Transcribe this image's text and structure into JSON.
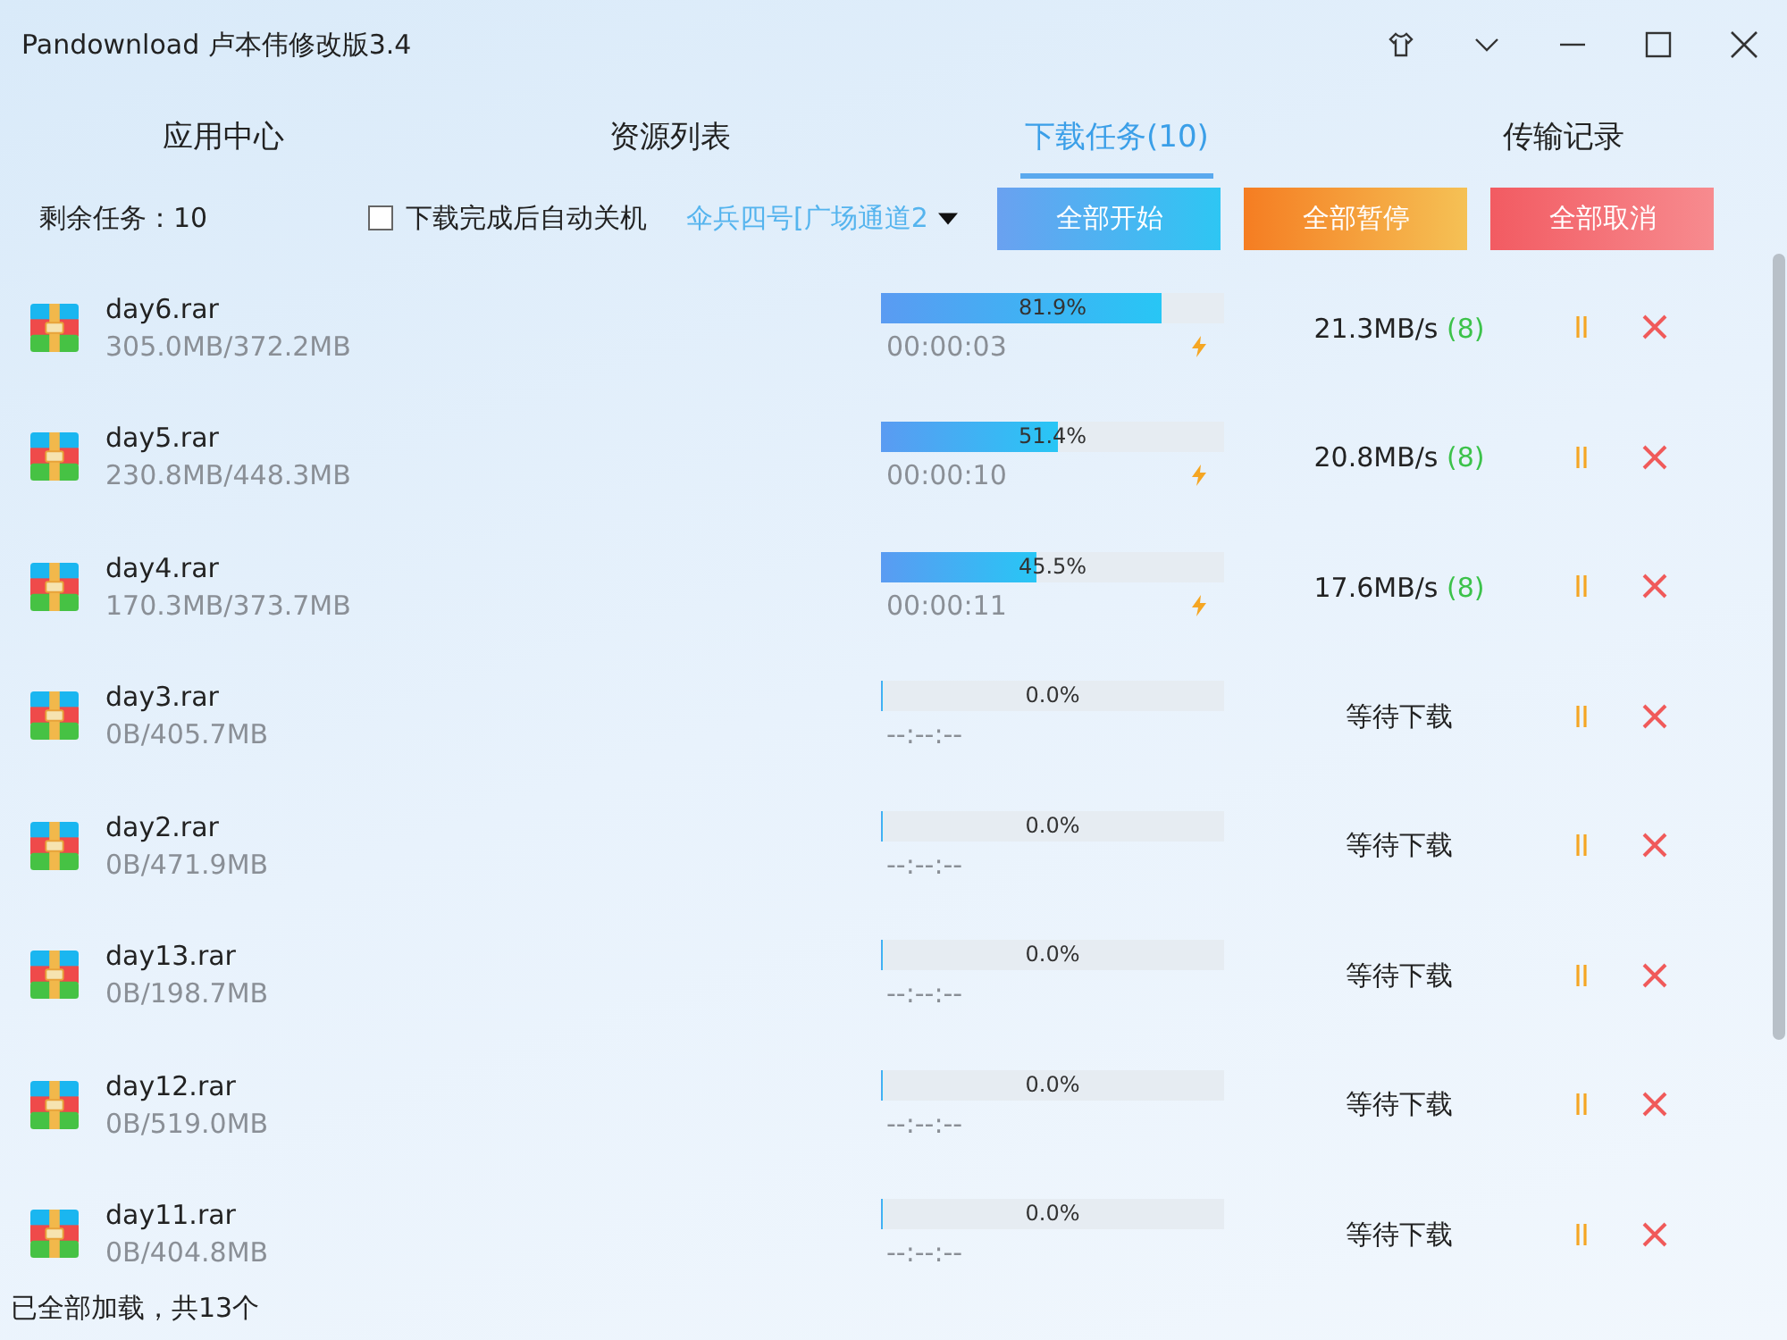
{
  "window": {
    "title": "Pandownload 卢本伟修改版3.4"
  },
  "tabs": [
    {
      "label": "应用中心",
      "selected": false
    },
    {
      "label": "资源列表",
      "selected": false
    },
    {
      "label": "下载任务(10)",
      "selected": true
    },
    {
      "label": "传输记录",
      "selected": false
    }
  ],
  "toolbar": {
    "remaining": "剩余任务：10",
    "auto_shutdown": {
      "label": "下载完成后自动关机",
      "checked": false
    },
    "channel": "伞兵四号[广场通道2",
    "buttons": [
      {
        "label": "全部开始",
        "kind": "start"
      },
      {
        "label": "全部暂停",
        "kind": "pause"
      },
      {
        "label": "全部取消",
        "kind": "cancel"
      }
    ]
  },
  "tasks": [
    {
      "name": "day6.rar",
      "size": "305.0MB/372.2MB",
      "level": 0.819,
      "percent": "81.9%",
      "time": "00:00:03",
      "kind": "active",
      "speed": "21.3MB/s",
      "threads": "(8)"
    },
    {
      "name": "day5.rar",
      "size": "230.8MB/448.3MB",
      "level": 0.514,
      "percent": "51.4%",
      "time": "00:00:10",
      "kind": "active",
      "speed": "20.8MB/s",
      "threads": "(8)"
    },
    {
      "name": "day4.rar",
      "size": "170.3MB/373.7MB",
      "level": 0.455,
      "percent": "45.5%",
      "time": "00:00:11",
      "kind": "active",
      "speed": "17.6MB/s",
      "threads": "(8)"
    },
    {
      "name": "day3.rar",
      "size": "0B/405.7MB",
      "level": 0,
      "percent": "0.0%",
      "time": "--:--:--",
      "kind": "waiting",
      "status": "等待下载"
    },
    {
      "name": "day2.rar",
      "size": "0B/471.9MB",
      "level": 0,
      "percent": "0.0%",
      "time": "--:--:--",
      "kind": "waiting",
      "status": "等待下载"
    },
    {
      "name": "day13.rar",
      "size": "0B/198.7MB",
      "level": 0,
      "percent": "0.0%",
      "time": "--:--:--",
      "kind": "waiting",
      "status": "等待下载"
    },
    {
      "name": "day12.rar",
      "size": "0B/519.0MB",
      "level": 0,
      "percent": "0.0%",
      "time": "--:--:--",
      "kind": "waiting",
      "status": "等待下载"
    },
    {
      "name": "day11.rar",
      "size": "0B/404.8MB",
      "level": 0,
      "percent": "0.0%",
      "time": "--:--:--",
      "kind": "waiting",
      "status": "等待下载"
    }
  ],
  "status_bar": "已全部加载，共13个"
}
